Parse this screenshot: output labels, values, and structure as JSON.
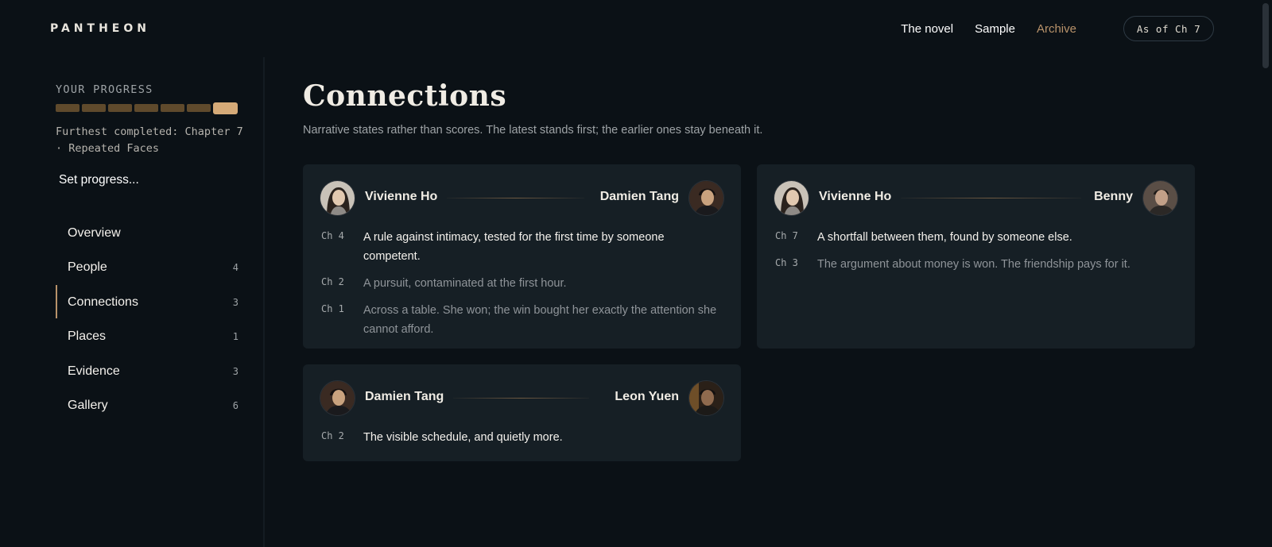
{
  "header": {
    "brand": "PANTHEON",
    "nav": [
      {
        "label": "The novel"
      },
      {
        "label": "Sample"
      },
      {
        "label": "Archive",
        "active": true
      }
    ],
    "as_of": "As of Ch 7"
  },
  "sidebar": {
    "progress_title": "YOUR PROGRESS",
    "progress_segments": 7,
    "progress_current": 7,
    "furthest": "Furthest completed: Chapter 7 · Repeated Faces",
    "set_progress": "Set progress...",
    "items": [
      {
        "label": "Overview",
        "count": ""
      },
      {
        "label": "People",
        "count": "4"
      },
      {
        "label": "Connections",
        "count": "3",
        "active": true
      },
      {
        "label": "Places",
        "count": "1"
      },
      {
        "label": "Evidence",
        "count": "3"
      },
      {
        "label": "Gallery",
        "count": "6"
      }
    ]
  },
  "main": {
    "title": "Connections",
    "subtitle": "Narrative states rather than scores. The latest stands first; the earlier ones stay beneath it.",
    "cards": [
      {
        "left": "Vivienne Ho",
        "right": "Damien Tang",
        "entries": [
          {
            "ch": "Ch 4",
            "text": "A rule against intimacy, tested for the first time by someone competent."
          },
          {
            "ch": "Ch 2",
            "text": "A pursuit, contaminated at the first hour."
          },
          {
            "ch": "Ch 1",
            "text": "Across a table. She won; the win bought her exactly the attention she cannot afford."
          }
        ]
      },
      {
        "left": "Vivienne Ho",
        "right": "Benny",
        "entries": [
          {
            "ch": "Ch 7",
            "text": "A shortfall between them, found by someone else."
          },
          {
            "ch": "Ch 3",
            "text": "The argument about money is won. The friendship pays for it."
          }
        ]
      },
      {
        "left": "Damien Tang",
        "right": "Leon Yuen",
        "entries": [
          {
            "ch": "Ch 2",
            "text": "The visible schedule, and quietly more."
          }
        ]
      }
    ]
  },
  "colors": {
    "background": "#0b1116",
    "card": "#161f25",
    "accent": "#b8926a",
    "progress_done": "#5f4a2c",
    "progress_current": "#d5aa78"
  }
}
